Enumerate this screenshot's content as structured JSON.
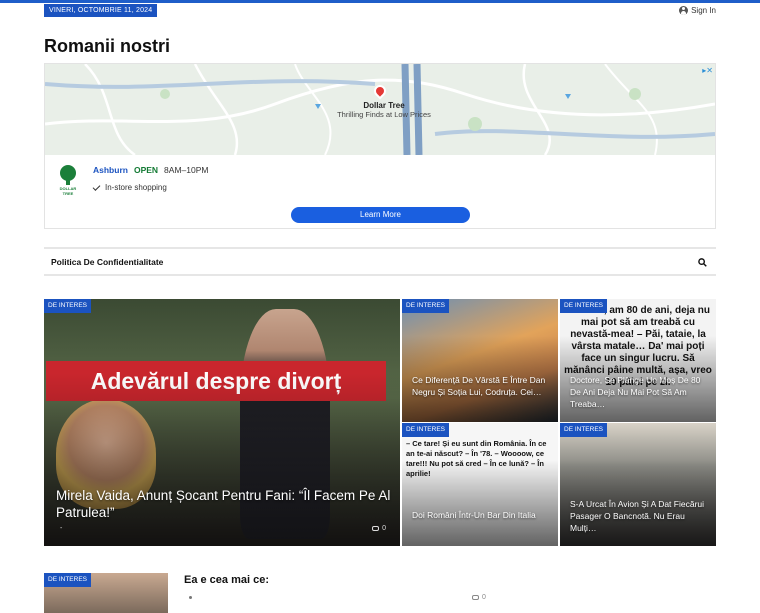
{
  "topbar": {
    "date": "VINERI, OCTOMBRIE 11, 2024",
    "signin_label": "Sign In"
  },
  "site": {
    "logo": "Romanii nostri"
  },
  "ad": {
    "store_name": "Dollar Tree",
    "tagline": "Thrilling Finds at Low Prices",
    "logo_text": "DOLLAR TREE",
    "city": "Ashburn",
    "status": "OPEN",
    "hours": "8AM–10PM",
    "feature": "In-store shopping",
    "cta": "Learn More",
    "colors": {
      "cta": "#1a5fe0",
      "open": "#137a34"
    }
  },
  "nav": {
    "items": [
      {
        "label": "Politica De Confidentialitate"
      }
    ]
  },
  "featured": {
    "badge": "DE INTERES",
    "banner_text": "Adevărul despre divorț",
    "title": "Mirela Vaida, Anunț Șocant Pentru Fani: “Îl Facem Pe Al Patrulea!”",
    "meta": "-",
    "comments": "0"
  },
  "cards": [
    {
      "badge": "DE INTERES",
      "title": "Ce Diferență De Vârstă E Între Dan Negru Și Soția Lui, Codruța. Cei…",
      "bg_text": ""
    },
    {
      "badge": "DE INTERES",
      "title": "Doctore, Se Plânge Un Moș De 80 De Ani Deja Nu Mai Pot Să Am Treaba…",
      "bg_text": "Doctore, am 80 de ani, deja nu mai pot să am treabă cu nevastă-mea! – Păi, tataie, la vârsta matale… Da' mai poți face un singur lucru. Să mănânci pâine multă, așa, vreo 10 pâini pe zi."
    },
    {
      "badge": "DE INTERES",
      "title": "Doi Români Într-Un Bar Din Italia",
      "bg_text": "– Ce tare! Și eu sunt din România. În ce an te-ai născut? – În '78. – Woooow, ce tare!!! Nu pot să cred – În ce lună? – În aprilie!"
    },
    {
      "badge": "DE INTERES",
      "title": "S-A Urcat În Avion Și A Dat Fiecărui Pasager O Bancnotă. Nu Erau Mulți…",
      "bg_text": ""
    }
  ],
  "bottom": {
    "badge": "DE INTERES",
    "title": "Ea e cea mai ce:",
    "comments": "0"
  }
}
